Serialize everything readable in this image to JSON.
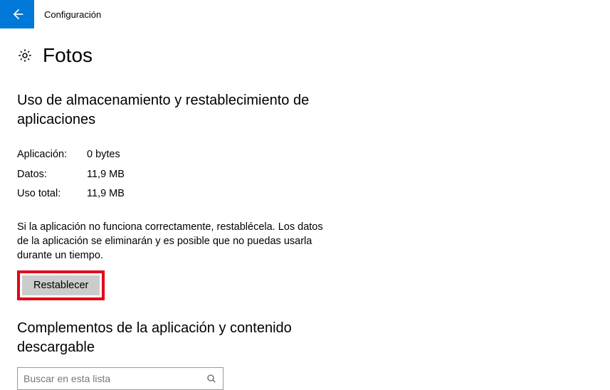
{
  "header": {
    "title": "Configuración"
  },
  "page": {
    "title": "Fotos"
  },
  "storage": {
    "section_title": "Uso de almacenamiento y restablecimiento de aplicaciones",
    "rows": [
      {
        "label": "Aplicación:",
        "value": "0 bytes"
      },
      {
        "label": "Datos:",
        "value": "11,9 MB"
      },
      {
        "label": "Uso total:",
        "value": "11,9 MB"
      }
    ],
    "description": "Si la aplicación no funciona correctamente, restablécela. Los datos de la aplicación se eliminarán y es posible que no puedas usarla durante un tiempo.",
    "reset_label": "Restablecer"
  },
  "addons": {
    "section_title": "Complementos de la aplicación y contenido descargable",
    "search_placeholder": "Buscar en esta lista"
  }
}
